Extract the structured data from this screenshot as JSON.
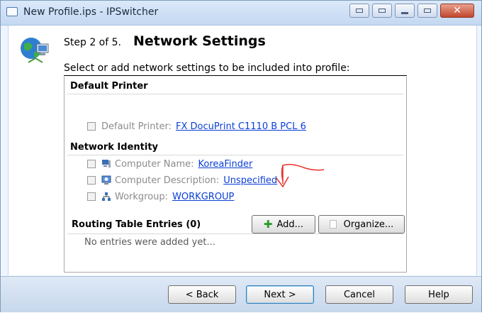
{
  "window": {
    "title": "New Profile.ips - IPSwitcher"
  },
  "header": {
    "step": "Step 2 of 5.",
    "title": "Network Settings",
    "instruction": "Select or add network settings to be included into profile:"
  },
  "default_printer": {
    "heading": "Default Printer",
    "label": "Default Printer:",
    "value": "FX DocuPrint C1110 B PCL 6",
    "checked": false
  },
  "network_identity": {
    "heading": "Network Identity",
    "items": [
      {
        "label": "Computer Name:",
        "value": "KoreaFinder",
        "icon": "computer-icon",
        "checked": false
      },
      {
        "label": "Computer Description:",
        "value": "Unspecified",
        "icon": "monitor-description-icon",
        "checked": false
      },
      {
        "label": "Workgroup:",
        "value": "WORKGROUP",
        "icon": "workgroup-icon",
        "checked": false
      }
    ]
  },
  "routing": {
    "heading": "Routing Table Entries (0)",
    "add_label": "Add...",
    "organize_label": "Organize...",
    "empty_text": "No entries were added yet..."
  },
  "footer": {
    "back_label": "< Back",
    "next_label": "Next >",
    "cancel_label": "Cancel",
    "help_label": "Help"
  },
  "colors": {
    "link": "#0b3fd6",
    "annotation": "#e8312a",
    "add_icon": "#2c9b2c"
  }
}
